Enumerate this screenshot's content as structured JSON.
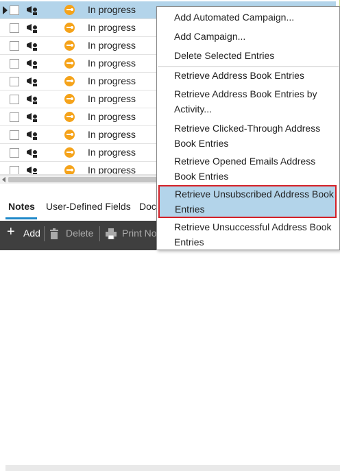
{
  "grid": {
    "rows": [
      {
        "status": "In progress",
        "selected": true
      },
      {
        "status": "In progress",
        "selected": false
      },
      {
        "status": "In progress",
        "selected": false
      },
      {
        "status": "In progress",
        "selected": false
      },
      {
        "status": "In progress",
        "selected": false
      },
      {
        "status": "In progress",
        "selected": false
      },
      {
        "status": "In progress",
        "selected": false
      },
      {
        "status": "In progress",
        "selected": false
      },
      {
        "status": "In progress",
        "selected": false
      },
      {
        "status": "In progress",
        "selected": false
      }
    ]
  },
  "tabs": [
    "Notes",
    "User-Defined Fields",
    "Doc"
  ],
  "toolbar": {
    "add": "Add",
    "delete": "Delete",
    "print": "Print No"
  },
  "menu": {
    "items": [
      "Add Automated Campaign...",
      "Add Campaign...",
      "Delete Selected Entries",
      "Retrieve Address Book Entries",
      "Retrieve Address Book Entries by Activity...",
      "Retrieve Clicked-Through Address Book Entries",
      "Retrieve Opened Emails Address Book Entries",
      "Retrieve Unsubscribed Address Book Entries",
      "Retrieve Unsuccessful Address Book Entries"
    ],
    "highlighted": "Retrieve Unsubscribed Address Book Entries"
  },
  "colors": {
    "accent": "#1e88c9",
    "highlight": "#b3d4ea",
    "highlight_border": "#d42027",
    "status_icon": "#f5a31a"
  }
}
